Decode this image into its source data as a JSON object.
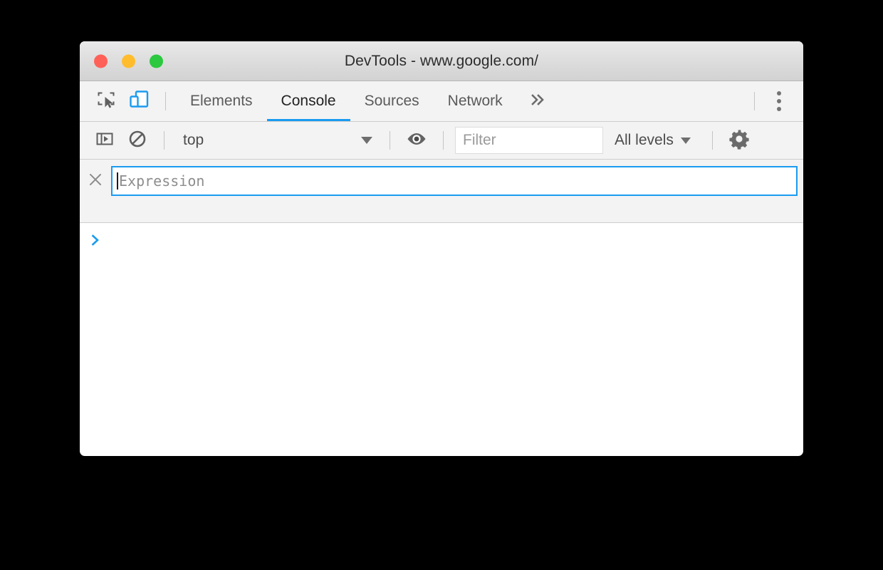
{
  "window": {
    "title": "DevTools - www.google.com/",
    "traffic_lights": [
      {
        "name": "close",
        "color": "#ff6159"
      },
      {
        "name": "minimize",
        "color": "#ffbd2e"
      },
      {
        "name": "maximize",
        "color": "#2bc840"
      }
    ]
  },
  "main_toolbar": {
    "inspect_icon": "inspect-element-icon",
    "device_toolbar_icon": "device-toolbar-icon",
    "device_toolbar_active": true,
    "tabs": [
      {
        "label": "Elements",
        "active": false
      },
      {
        "label": "Console",
        "active": true
      },
      {
        "label": "Sources",
        "active": false
      },
      {
        "label": "Network",
        "active": false
      }
    ],
    "more_tabs_label": "»",
    "menu_icon": "more-vertical-icon"
  },
  "console_toolbar": {
    "sidebar_toggle_icon": "console-sidebar-icon",
    "clear_console_icon": "clear-console-icon",
    "context": {
      "value": "top",
      "caret": "▼"
    },
    "live_expression_icon": "eye-icon",
    "filter": {
      "placeholder": "Filter",
      "value": ""
    },
    "levels": {
      "value": "All levels",
      "caret": "▼"
    },
    "settings_icon": "gear-icon"
  },
  "live_expression": {
    "remove_icon": "close-icon",
    "placeholder": "Expression",
    "value": "",
    "focused": true
  },
  "console_output": {
    "prompt": ">",
    "entries": []
  },
  "colors": {
    "accent": "#1a9bf0",
    "toolbar_bg": "#f3f3f3",
    "titlebar_bg": "#dcdcdc",
    "text": "#4c4c4c",
    "placeholder": "#9a9a9a"
  }
}
